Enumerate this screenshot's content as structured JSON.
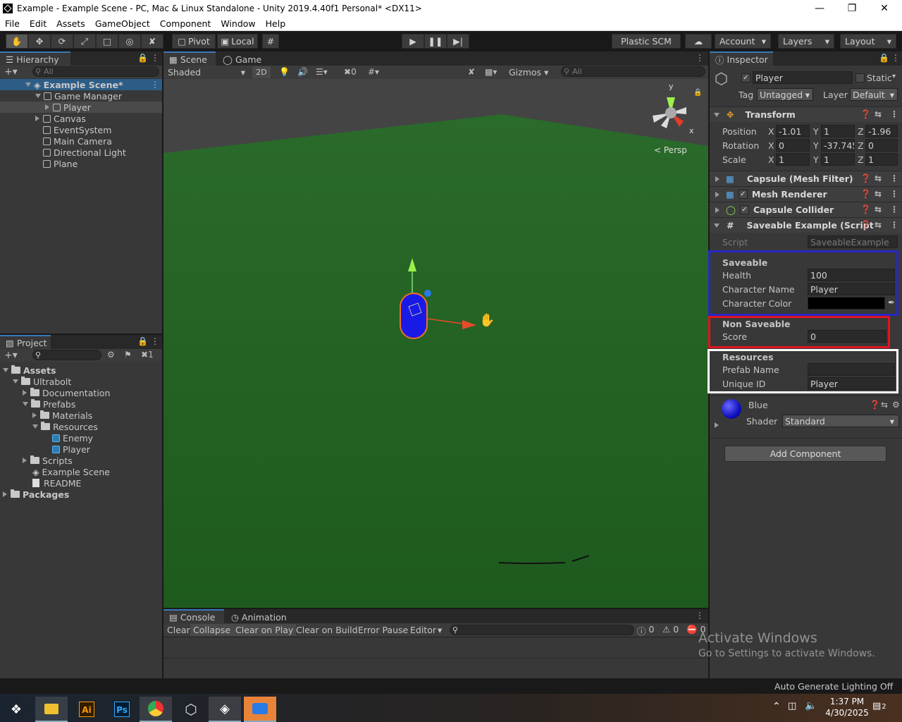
{
  "window": {
    "title": "Example - Example Scene - PC, Mac & Linux Standalone - Unity 2019.4.40f1 Personal* <DX11>"
  },
  "menu": [
    "File",
    "Edit",
    "Assets",
    "GameObject",
    "Component",
    "Window",
    "Help"
  ],
  "toolbar": {
    "pivot": "Pivot",
    "local": "Local",
    "plastic": "Plastic SCM",
    "account": "Account",
    "layers": "Layers",
    "layout": "Layout"
  },
  "hierarchy": {
    "tab": "Hierarchy",
    "search_placeholder": "All",
    "scene": "Example Scene*",
    "items": [
      "Game Manager",
      "Player",
      "Canvas",
      "EventSystem",
      "Main Camera",
      "Directional Light",
      "Plane"
    ]
  },
  "scene_view": {
    "tabs": [
      "Scene",
      "Game"
    ],
    "shading": "Shaded",
    "mode_2d": "2D",
    "hidden_count": "0",
    "gizmos": "Gizmos",
    "search_placeholder": "All",
    "persp": "Persp",
    "axis_y": "y",
    "axis_x": "x"
  },
  "project": {
    "tab": "Project",
    "hidden_count": "1",
    "items": [
      "Assets",
      "Ultrabolt",
      "Documentation",
      "Prefabs",
      "Materials",
      "Resources",
      "Enemy",
      "Player",
      "Scripts",
      "Example Scene",
      "README",
      "Packages"
    ]
  },
  "console": {
    "tabs": [
      "Console",
      "Animation"
    ],
    "buttons": [
      "Clear",
      "Collapse",
      "Clear on Play",
      "Clear on Build",
      "Error Pause",
      "Editor"
    ],
    "counts": [
      "0",
      "0",
      "0"
    ]
  },
  "inspector": {
    "tab": "Inspector",
    "object_name": "Player",
    "static_label": "Static",
    "tag_label": "Tag",
    "tag_value": "Untagged",
    "layer_label": "Layer",
    "layer_value": "Default",
    "transform": {
      "title": "Transform",
      "position_label": "Position",
      "position": [
        "-1.01",
        "1",
        "-1.96"
      ],
      "rotation_label": "Rotation",
      "rotation": [
        "0",
        "-37.745",
        "0"
      ],
      "scale_label": "Scale",
      "scale": [
        "1",
        "1",
        "1"
      ]
    },
    "components": [
      "Capsule (Mesh Filter)",
      "Mesh Renderer",
      "Capsule Collider",
      "Saveable Example (Script"
    ],
    "script_label": "Script",
    "script_value": "SaveableExample",
    "saveable": {
      "header": "Saveable",
      "health_label": "Health",
      "health": "100",
      "name_label": "Character Name",
      "name": "Player",
      "color_label": "Character Color"
    },
    "non_saveable": {
      "header": "Non Saveable",
      "score_label": "Score",
      "score": "0"
    },
    "resources": {
      "header": "Resources",
      "prefab_label": "Prefab Name",
      "prefab": "",
      "uid_label": "Unique ID",
      "uid": "Player"
    },
    "material": {
      "name": "Blue",
      "shader_label": "Shader",
      "shader": "Standard"
    },
    "add_component": "Add Component"
  },
  "status_bar": {
    "text": "Auto Generate Lighting Off"
  },
  "watermark": {
    "line1": "Activate Windows",
    "line2": "Go to Settings to activate Windows."
  },
  "taskbar": {
    "time": "1:37 PM",
    "date": "4/30/2025",
    "notifications": "2"
  },
  "colors": {
    "accent": "#3a79bb",
    "ground": "#1e5a1e",
    "capsule": "#1a1ae6",
    "saveable_box": "#2727c8",
    "non_saveable_box": "#e0141e",
    "resources_box": "#ffffff"
  }
}
